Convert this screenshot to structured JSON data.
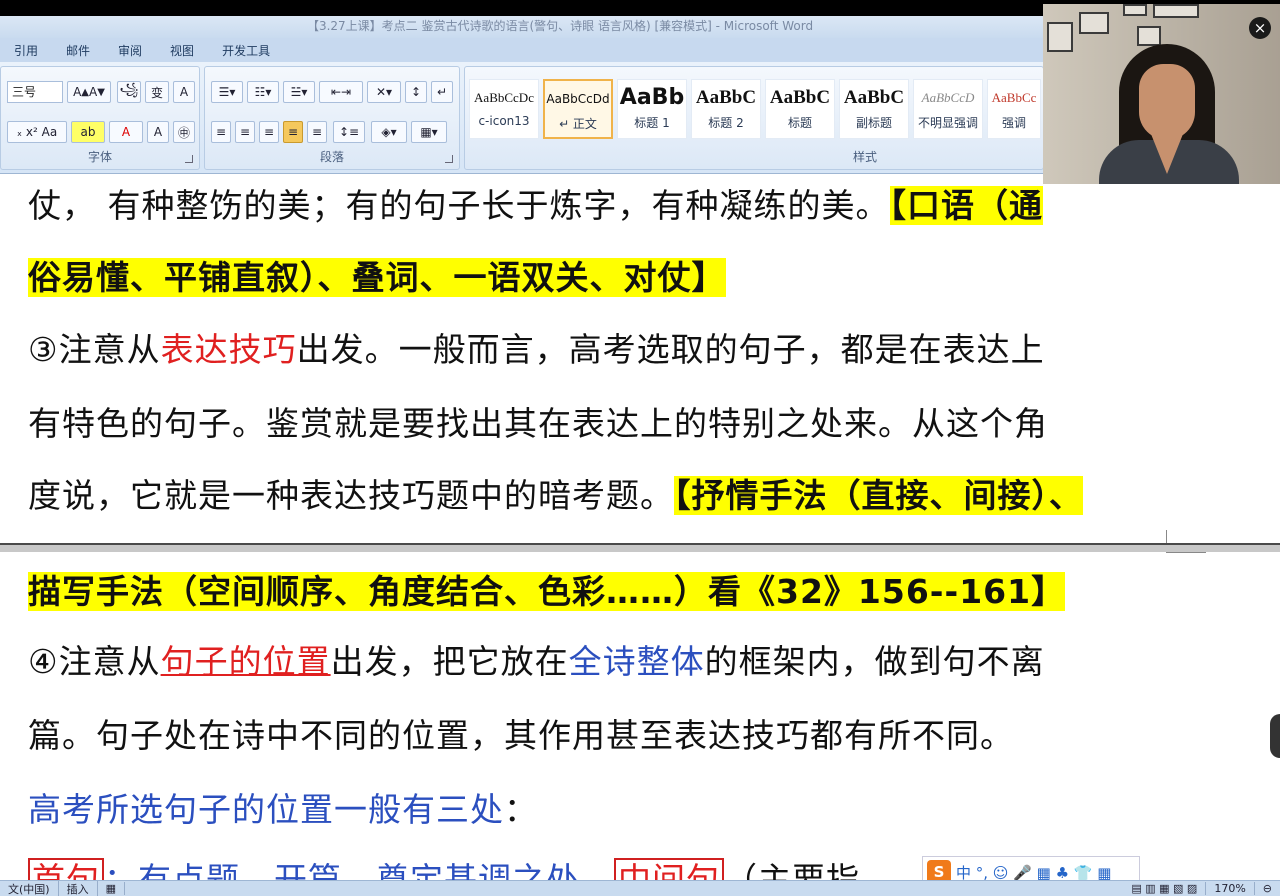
{
  "window": {
    "title": "【3.27上课】考点二  鉴赏古代诗歌的语言(警句、诗眼   语言风格) [兼容模式] - Microsoft Word"
  },
  "ribbon": {
    "tabs": [
      "引用",
      "邮件",
      "审阅",
      "视图",
      "开发工具"
    ],
    "font_group": {
      "label": "字体",
      "font_size": "三号"
    },
    "paragraph_group": {
      "label": "段落"
    },
    "styles_group": {
      "label": "样式",
      "styles": [
        {
          "preview": "AaBbCcDc",
          "name": "c-icon13"
        },
        {
          "preview": "AaBbCcDd",
          "name": "↵ 正文"
        },
        {
          "preview": "AaBb",
          "name": "标题 1"
        },
        {
          "preview": "AaBbC",
          "name": "标题 2"
        },
        {
          "preview": "AaBbC",
          "name": "标题"
        },
        {
          "preview": "AaBbC",
          "name": "副标题"
        },
        {
          "preview": "AaBbCcD",
          "name": "不明显强调"
        },
        {
          "preview": "AaBbCc",
          "name": "强调"
        }
      ]
    }
  },
  "document": {
    "l1_a": "仗， 有种整饬的美；有的句子长于炼字，有种凝练的美。",
    "l1_b": "【口语（通",
    "l2": "俗易懂、平铺直叙）、叠词、一语双关、对仗】",
    "l3_a": "③注意从",
    "l3_b": "表达技巧",
    "l3_c": "出发。一般而言，高考选取的句子，都是在表达上",
    "l4": "有特色的句子。鉴赏就是要找出其在表达上的特别之处来。从这个角",
    "l5_a": "度说，它就是一种表达技巧题中的暗考题。",
    "l5_b": "【抒情手法（直接、间接）、",
    "l6": "描写手法（空间顺序、角度结合、色彩……）看《32》156--161】",
    "l7_a": "④注意从",
    "l7_b": "句子的位置",
    "l7_c": "出发，把它放在",
    "l7_d": "全诗整体",
    "l7_e": "的框架内，做到句不离",
    "l8": "篇。句子处在诗中不同的位置，其作用甚至表达技巧都有所不同。",
    "l9_a": "高考所选句子的位置一般有三处",
    "l9_b": "：",
    "l10_a": "首句",
    "l10_b": "：有点题、开篇、奠定基调之处。",
    "l10_c": "中间句",
    "l10_d": "（主要指"
  },
  "status": {
    "lang": "文(中国)",
    "mode": "插入",
    "zoom": "170%"
  },
  "ime": {
    "logo": "S",
    "text": "中 °, ☺ 🎤 ▦ ♣ 👕 ▦"
  },
  "colors": {
    "highlight": "#ffff00",
    "red": "#e02020",
    "blue": "#2b4fbf",
    "ribbon": "#d6e5f6"
  }
}
